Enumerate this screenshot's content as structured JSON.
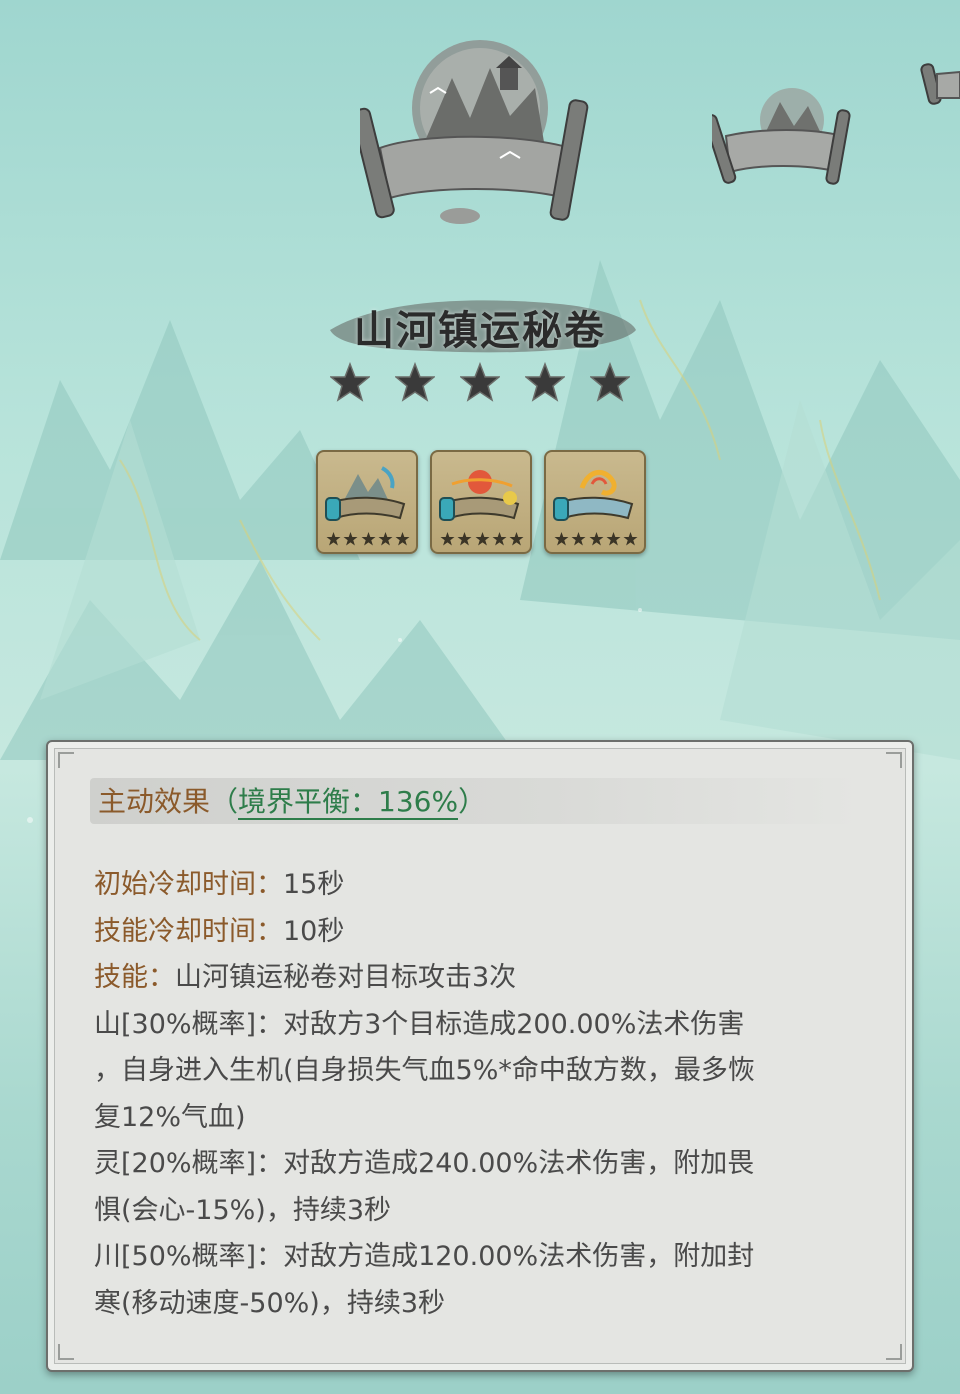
{
  "title": "山河镇运秘卷",
  "star_rating": 5,
  "slots": [
    {
      "name": "scroll-variant-mountain",
      "stars": 5
    },
    {
      "name": "scroll-variant-sun",
      "stars": 5
    },
    {
      "name": "scroll-variant-fire",
      "stars": 5
    }
  ],
  "panel": {
    "header_label": "主动效果",
    "header_open": "（",
    "header_balance": "境界平衡：136%",
    "header_close": "）",
    "init_cd_label": "初始冷却时间：",
    "init_cd_value": "15秒",
    "skill_cd_label": "技能冷却时间：",
    "skill_cd_value": "10秒",
    "skill_label": "技能：",
    "skill_value": "山河镇运秘卷对目标攻击3次",
    "lines": [
      "山[30%概率]：对敌方3个目标造成200.00%法术伤害",
      "，自身进入生机(自身损失气血5%*命中敌方数，最多恢",
      "复12%气血)",
      "灵[20%概率]：对敌方造成240.00%法术伤害，附加畏",
      "惧(会心-15%)，持续3秒",
      "川[50%概率]：对敌方造成120.00%法术伤害，附加封",
      "寒(移动速度-50%)，持续3秒"
    ]
  },
  "colors": {
    "label_brown": "#8b5a2b",
    "accent_green": "#2e7d4a",
    "body_text": "#4a4a4a",
    "star_dark": "#3a3a3a"
  }
}
